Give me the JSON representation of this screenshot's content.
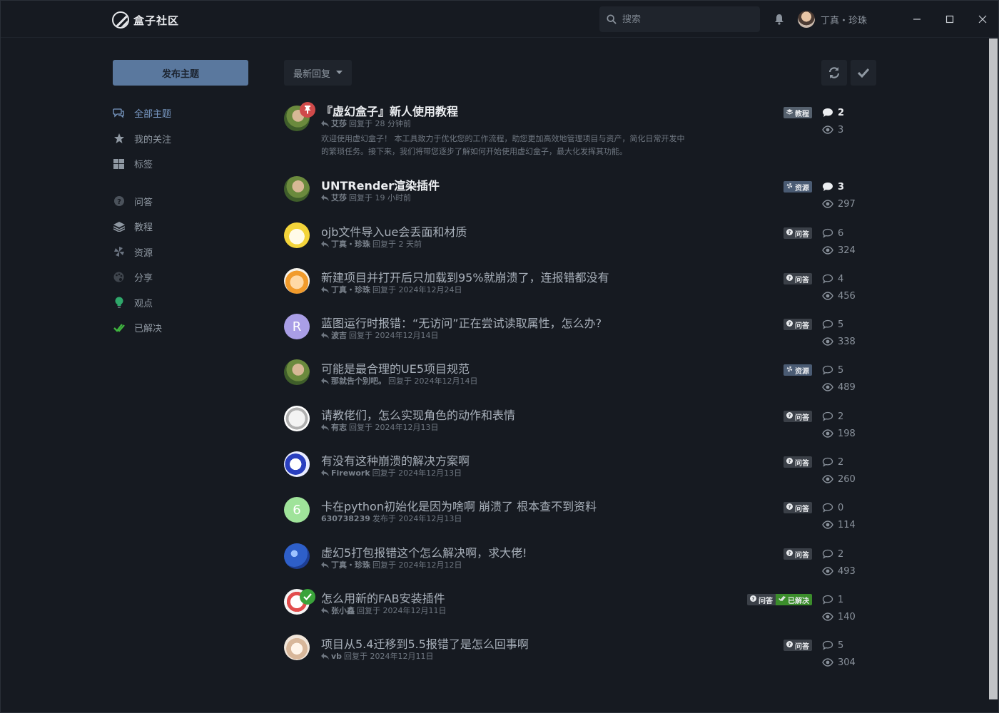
{
  "app": {
    "name": "盒子社区"
  },
  "search": {
    "placeholder": "搜索"
  },
  "user": {
    "name": "丁真・珍珠"
  },
  "sidebar": {
    "new_topic_label": "发布主题",
    "items": [
      {
        "label": "全部主题",
        "icon": "comments-icon"
      },
      {
        "label": "我的关注",
        "icon": "star-icon"
      },
      {
        "label": "标签",
        "icon": "grid-icon"
      },
      {
        "label": "问答",
        "icon": "question-icon"
      },
      {
        "label": "教程",
        "icon": "layers-icon"
      },
      {
        "label": "资源",
        "icon": "pinwheel-icon"
      },
      {
        "label": "分享",
        "icon": "palette-icon"
      },
      {
        "label": "观点",
        "icon": "lightbulb-icon"
      },
      {
        "label": "已解决",
        "icon": "check-double-icon"
      }
    ]
  },
  "toolbar": {
    "sort_label": "最新回复"
  },
  "tags": {
    "tutorial": "教程",
    "resource": "资源",
    "qa": "问答",
    "solved": "已解决"
  },
  "topics": [
    {
      "title": "『虚幻盒子』新人使用教程",
      "user": "艾莎",
      "action": "回复于 28 分钟前",
      "excerpt": "欢迎使用虚幻盒子！ 本工具致力于优化您的工作流程，助您更加高效地管理项目与资产，简化日常开发中的繁琐任务。接下来，我们将带您逐步了解如何开始使用虚幻盒子，最大化发挥其功能。",
      "tags": [
        "tutorial"
      ],
      "replies": "2",
      "views": "3",
      "unread": true
    },
    {
      "title": "UNTRender渲染插件",
      "user": "艾莎",
      "action": "回复于 19 小时前",
      "tags": [
        "resource"
      ],
      "replies": "3",
      "views": "297",
      "unread": true
    },
    {
      "title": "ojb文件导入ue会丢面和材质",
      "user": "丁真・珍珠",
      "action": "回复于 2 天前",
      "tags": [
        "qa"
      ],
      "replies": "6",
      "views": "324"
    },
    {
      "title": "新建项目并打开后只加载到95%就崩溃了，连报错都没有",
      "user": "丁真・珍珠",
      "action": "回复于 2024年12月24日",
      "tags": [
        "qa"
      ],
      "replies": "4",
      "views": "456"
    },
    {
      "title": "蓝图运行时报错：“无访问”正在尝试读取属性，怎么办?",
      "user": "波吉",
      "action": "回复于 2024年12月14日",
      "tags": [
        "qa"
      ],
      "replies": "5",
      "views": "338",
      "letter": "R"
    },
    {
      "title": "可能是最合理的UE5项目规范",
      "user": "那就告个别吧。",
      "action": "回复于 2024年12月14日",
      "tags": [
        "resource"
      ],
      "replies": "5",
      "views": "489"
    },
    {
      "title": "请教佬们，怎么实现角色的动作和表情",
      "user": "有志",
      "action": "回复于 2024年12月13日",
      "tags": [
        "qa"
      ],
      "replies": "2",
      "views": "198"
    },
    {
      "title": "有没有这种崩溃的解决方案啊",
      "user": "Firework",
      "action": "回复于 2024年12月13日",
      "tags": [
        "qa"
      ],
      "replies": "2",
      "views": "260"
    },
    {
      "title": "卡在python初始化是因为啥啊 崩溃了 根本查不到资料",
      "user": "630738239",
      "action": "发布于 2024年12月13日",
      "tags": [
        "qa"
      ],
      "replies": "0",
      "views": "114",
      "letter": "6",
      "no_reply_icon": true
    },
    {
      "title": "虚幻5打包报错这个怎么解决啊，求大佬!",
      "user": "丁真・珍珠",
      "action": "回复于 2024年12月12日",
      "tags": [
        "qa"
      ],
      "replies": "2",
      "views": "493"
    },
    {
      "title": "怎么用新的FAB安装插件",
      "user": "张小鑫",
      "action": "回复于 2024年12月11日",
      "tags": [
        "qa",
        "solved"
      ],
      "replies": "1",
      "views": "140",
      "solved": true
    },
    {
      "title": "项目从5.4迁移到5.5报错了是怎么回事啊",
      "user": "vb",
      "action": "回复于 2024年12月11日",
      "tags": [
        "qa"
      ],
      "replies": "5",
      "views": "304"
    }
  ],
  "colors": {
    "background": "#161a21",
    "primary_button": "#5a789e",
    "active_nav": "#7b9bc6",
    "pin": "#d04a4a",
    "solved": "#3b8d2b"
  }
}
